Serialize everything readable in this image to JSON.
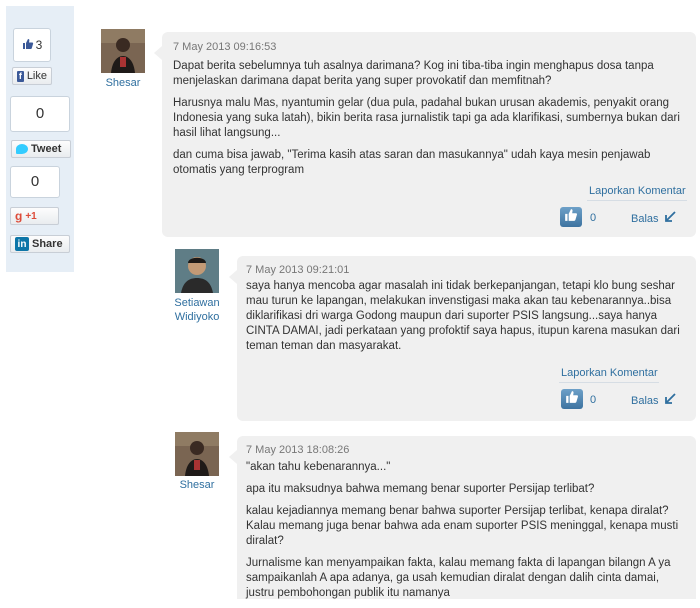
{
  "share": {
    "facebook": {
      "count": "3",
      "label": "Like",
      "glyph": "f"
    },
    "twitter": {
      "count": "0",
      "label": "Tweet"
    },
    "google": {
      "count": "0",
      "label": "+1",
      "glyph": "g"
    },
    "linkedin": {
      "label": "Share",
      "glyph": "in"
    }
  },
  "comments": [
    {
      "author": "Shesar",
      "date": "7 May 2013 09:16:53",
      "paragraphs": [
        "Dapat berita sebelumnya tuh asalnya darimana? Kog ini tiba-tiba ingin menghapus dosa tanpa menjelaskan darimana dapat berita yang super provokatif dan memfitnah?",
        "Harusnya malu Mas, nyantumin gelar (dua pula, padahal bukan urusan akademis, penyakit orang Indonesia yang suka latah), bikin berita rasa jurnalistik tapi ga ada klarifikasi, sumbernya bukan dari hasil lihat langsung...",
        "dan cuma bisa jawab, \"Terima kasih atas saran dan masukannya\" udah kaya mesin penjawab otomatis yang terprogram"
      ],
      "report_label": "Laporkan Komentar",
      "like_count": "0",
      "reply_label": "Balas"
    },
    {
      "author_line1": "Setiawan",
      "author_line2": "Widiyoko",
      "date": "7 May 2013 09:21:01",
      "paragraphs": [
        "saya hanya mencoba agar masalah ini tidak berkepanjangan, tetapi klo bung seshar mau turun ke lapangan, melakukan invenstigasi maka akan tau kebenarannya..bisa diklarifikasi dri warga Godong maupun dari suporter PSIS langsung...saya hanya CINTA DAMAI, jadi perkataan yang profoktif saya hapus, itupun karena masukan dari teman teman dan masyarakat."
      ],
      "report_label": "Laporkan Komentar",
      "like_count": "0",
      "reply_label": "Balas"
    },
    {
      "author": "Shesar",
      "date": "7 May 2013 18:08:26",
      "paragraphs": [
        "\"akan tahu kebenarannya...\"",
        "apa itu maksudnya bahwa memang benar suporter Persijap terlibat?",
        "kalau kejadiannya memang benar bahwa suporter Persijap terlibat, kenapa diralat? Kalau memang juga benar bahwa ada enam suporter PSIS meninggal, kenapa musti diralat?",
        "Jurnalisme kan menyampaikan fakta, kalau memang fakta di lapangan bilangn A ya sampaikanlah A apa adanya, ga usah kemudian diralat dengan dalih cinta damai, justru pembohongan publik itu namanya"
      ]
    }
  ]
}
